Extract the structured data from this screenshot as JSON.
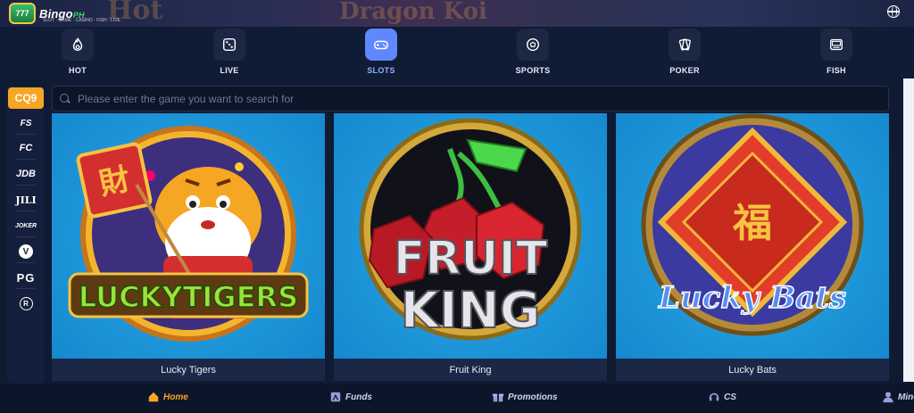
{
  "brand": {
    "name": "Bingo",
    "badge_text": "777",
    "logo_suffix": "PH",
    "tagline": "SLOT · GAME · CASINO · FISH · LIVE"
  },
  "banner": {
    "text_left": "Hot",
    "text_center": "Dragon Koi"
  },
  "categories": [
    {
      "label": "HOT",
      "icon": "flame-icon",
      "active": false
    },
    {
      "label": "LIVE",
      "icon": "dice-icon",
      "active": false
    },
    {
      "label": "SLOTS",
      "icon": "gamepad-icon",
      "active": true
    },
    {
      "label": "SPORTS",
      "icon": "soccer-ball-icon",
      "active": false
    },
    {
      "label": "POKER",
      "icon": "cards-icon",
      "active": false
    },
    {
      "label": "FISH",
      "icon": "fish-machine-icon",
      "active": false
    }
  ],
  "providers": [
    {
      "label": "CQ9",
      "active": true
    },
    {
      "label": "FS",
      "active": false
    },
    {
      "label": "FC",
      "active": false
    },
    {
      "label": "JDB",
      "active": false
    },
    {
      "label": "JILI",
      "active": false
    },
    {
      "label": "JOKER",
      "active": false
    },
    {
      "label": "V",
      "active": false
    },
    {
      "label": "PG",
      "active": false
    },
    {
      "label": "R",
      "active": false
    }
  ],
  "search": {
    "placeholder": "Please enter the game you want to search for"
  },
  "games": [
    {
      "name": "Lucky Tigers",
      "logo_text": "LUCKYTIGERS",
      "badge": "財"
    },
    {
      "name": "Fruit King",
      "logo_line1": "FRUIT",
      "logo_line2": "KING"
    },
    {
      "name": "Lucky Bats",
      "logo_text": "Lucky Bats",
      "badge": "福"
    }
  ],
  "bottom_nav": [
    {
      "label": "Home",
      "icon": "home-icon",
      "active": true
    },
    {
      "label": "Funds",
      "icon": "wallet-icon",
      "active": false
    },
    {
      "label": "Promotions",
      "icon": "gift-icon",
      "active": false
    },
    {
      "label": "CS",
      "icon": "headset-icon",
      "active": false
    },
    {
      "label": "Mine",
      "icon": "user-icon",
      "active": false
    }
  ],
  "colors": {
    "accent": "#f5a623",
    "active_category": "#5f87ff",
    "background": "#0f1a33"
  }
}
